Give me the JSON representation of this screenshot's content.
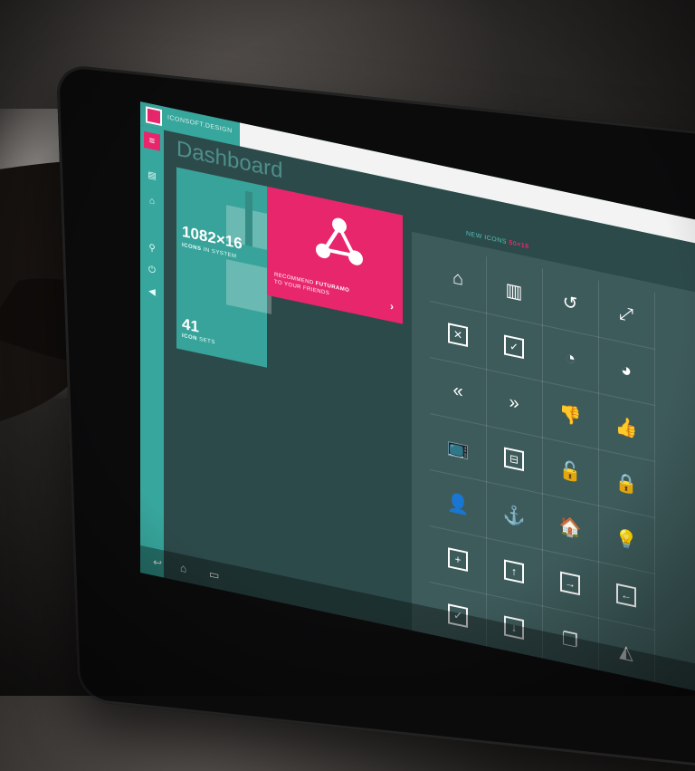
{
  "app": {
    "brand": "ICONSOFT.DESIGN",
    "page_title": "Dashboard"
  },
  "stats": {
    "icons_count": "1082×16",
    "icons_label_bold": "ICONS",
    "icons_label_rest": " IN SYSTEM",
    "sets_count": "41",
    "sets_label_bold": "ICON",
    "sets_label_rest": " SETS"
  },
  "promo": {
    "line1_pre": "RECOMMEND ",
    "line1_bold": "FUTURAMO",
    "line2": "TO YOUR FRIENDS",
    "cta_glyph": "›"
  },
  "new_icons": {
    "label": "NEW ICONS",
    "count": "50",
    "sep": "×",
    "size": "16"
  },
  "icons": [
    {
      "name": "home-icon",
      "glyph": "⌂"
    },
    {
      "name": "buildings-icon",
      "glyph": "▥"
    },
    {
      "name": "refresh-icon",
      "glyph": "↺"
    },
    {
      "name": "resize-icon",
      "glyph": "⤢"
    },
    {
      "name": "message-delete-icon",
      "glyph": "✕",
      "boxed": true
    },
    {
      "name": "message-check-icon",
      "glyph": "✓",
      "boxed": true
    },
    {
      "name": "pacman-icon",
      "glyph": "◔"
    },
    {
      "name": "pacman-alt-icon",
      "glyph": "◕"
    },
    {
      "name": "double-left-icon",
      "glyph": "«"
    },
    {
      "name": "double-right-icon",
      "glyph": "»"
    },
    {
      "name": "thumbs-down-icon",
      "glyph": "👎"
    },
    {
      "name": "thumbs-up-icon",
      "glyph": "👍"
    },
    {
      "name": "tv-icon",
      "glyph": "📺"
    },
    {
      "name": "door-icon",
      "glyph": "⊟",
      "boxed": true
    },
    {
      "name": "unlock-icon",
      "glyph": "🔓"
    },
    {
      "name": "lock-icon",
      "glyph": "🔒"
    },
    {
      "name": "user-lock-icon",
      "glyph": "👤"
    },
    {
      "name": "anchor-icon",
      "glyph": "⚓"
    },
    {
      "name": "house-icon",
      "glyph": "🏠"
    },
    {
      "name": "bulb-icon",
      "glyph": "💡"
    },
    {
      "name": "plus-box-icon",
      "glyph": "+",
      "boxed": true
    },
    {
      "name": "arrow-up-box-icon",
      "glyph": "↑",
      "boxed": true
    },
    {
      "name": "arrow-right-box-icon",
      "glyph": "→",
      "boxed": true
    },
    {
      "name": "arrow-left-box-icon",
      "glyph": "←",
      "boxed": true
    },
    {
      "name": "check-box-icon",
      "glyph": "✓",
      "boxed": true
    },
    {
      "name": "arrow-down-box-icon",
      "glyph": "↓",
      "boxed": true
    },
    {
      "name": "copy-icon",
      "glyph": "❐"
    },
    {
      "name": "pizza-icon",
      "glyph": "◭"
    }
  ],
  "nav": {
    "back": "↩",
    "home": "⌂",
    "recent": "▭"
  },
  "colors": {
    "accent": "#e8266c",
    "teal": "#37a69c",
    "panel": "#3e5b5b",
    "bg": "#2d4a4a"
  }
}
